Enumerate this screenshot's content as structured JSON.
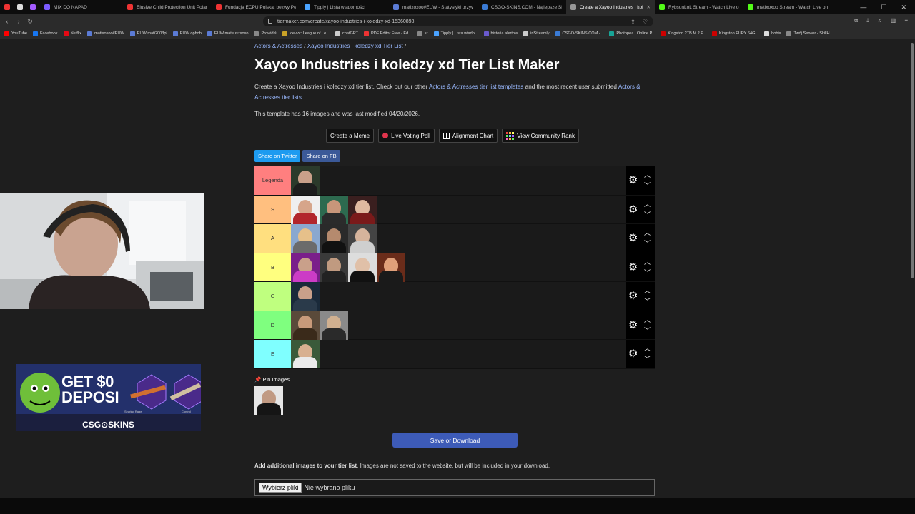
{
  "browser": {
    "tabs": [
      {
        "label": "MIX DO NAPAD",
        "color": "#7c5cff"
      },
      {
        "label": "Elusive Child Protection Unit Poland",
        "color": "#e33"
      },
      {
        "label": "Fundacja ECPU Polska: bezwy Pedofi",
        "color": "#e33"
      },
      {
        "label": "Tipply | Lista wiadomości",
        "color": "#4aa3ff"
      },
      {
        "label": "matixoxoo#EUW - Statystyki przywo",
        "color": "#5b7bd5"
      },
      {
        "label": "CSGO-SKINS.COM - Najlepsze Skrzy",
        "color": "#3a7bd5"
      },
      {
        "label": "Create a Xayoo Industries i kole",
        "color": "#999",
        "active": true
      },
      {
        "label": "RybsonLoL Stream - Watch Live on K",
        "color": "#53fc18"
      },
      {
        "label": "matixoxoo Stream - Watch Live on K",
        "color": "#53fc18"
      }
    ],
    "url": "tiermaker.com/create/xayoo-industries-i-koledzy-xd-15360898",
    "bookmarks": [
      {
        "label": "YouTube",
        "color": "#f00"
      },
      {
        "label": "Facebook",
        "color": "#1877f2"
      },
      {
        "label": "Netflix",
        "color": "#e50914"
      },
      {
        "label": "matixoxoo#EUW",
        "color": "#5b7bd5"
      },
      {
        "label": "EUW mati2003pl",
        "color": "#5b7bd5"
      },
      {
        "label": "EUW ophob",
        "color": "#5b7bd5"
      },
      {
        "label": "EUW mateuszxoxo",
        "color": "#5b7bd5"
      },
      {
        "label": "Prowidiś",
        "color": "#888"
      },
      {
        "label": "Icevvv: League of Le...",
        "color": "#c9a227"
      },
      {
        "label": "chatGPT",
        "color": "#ccc"
      },
      {
        "label": "PDF Editor Free - Ed...",
        "color": "#e33"
      },
      {
        "label": "sr",
        "color": "#888"
      },
      {
        "label": "Tipply | Lista wiado...",
        "color": "#4aa3ff"
      },
      {
        "label": "historia alertow",
        "color": "#6a5acd"
      },
      {
        "label": "irlStreamly",
        "color": "#ccc"
      },
      {
        "label": "CSGO-SKINS.COM -...",
        "color": "#3a7bd5"
      },
      {
        "label": "Photopea | Online P...",
        "color": "#18a497"
      },
      {
        "label": "Kingston 2TB M.2 P...",
        "color": "#c00"
      },
      {
        "label": "Kingston FURY 64G...",
        "color": "#c00"
      },
      {
        "label": "bobix",
        "color": "#ddd"
      },
      {
        "label": "Twój Serwer - SkillH...",
        "color": "#888"
      }
    ]
  },
  "page": {
    "breadcrumb": {
      "cat": "Actors & Actresses",
      "sep": "/",
      "name": "Xayoo Industries i koledzy xd Tier List",
      "tail": "/"
    },
    "title": "Xayoo Industries i koledzy xd Tier List Maker",
    "intro1": "Create a Xayoo Industries i koledzy xd tier list. Check out our other",
    "intro_link1": "Actors & Actresses tier list templates",
    "intro2": "and the most recent user submitted",
    "intro_link2": "Actors & Actresses tier lists",
    "intro3": ".",
    "info": "This template has 16 images and was last modified 04/20/2026.",
    "buttons": {
      "meme": "Create a Meme",
      "poll": "Live Voting Poll",
      "align": "Alignment Chart",
      "community": "View Community Rank"
    },
    "share": {
      "twitter": "Share on Twitter",
      "fb": "Share on FB"
    },
    "tiers": [
      {
        "label": "Legenda",
        "color": "#ff7f7f",
        "images": 1
      },
      {
        "label": "S",
        "color": "#ffbf7f",
        "images": 3
      },
      {
        "label": "A",
        "color": "#ffdf7f",
        "images": 3
      },
      {
        "label": "B",
        "color": "#ffff7f",
        "images": 4
      },
      {
        "label": "C",
        "color": "#bfff7f",
        "images": 1
      },
      {
        "label": "D",
        "color": "#7fff7f",
        "images": 2
      },
      {
        "label": "E",
        "color": "#7fffff",
        "images": 1
      }
    ],
    "pin_label": "Pin Images",
    "save_button": "Save or Download",
    "add_bold": "Add additional images to your tier list",
    "add_rest": ". Images are not saved to the website, but will be included in your download.",
    "file_button": "Wybierz pliki",
    "file_status": "Nie wybrano pliku"
  },
  "overlay": {
    "ad_line1": "GET $0",
    "ad_line2": "DEPOSI",
    "ad_brand": "CSG⊙SKINS",
    "ad_sub1": "Searing Rage",
    "ad_sub2": "Control"
  }
}
